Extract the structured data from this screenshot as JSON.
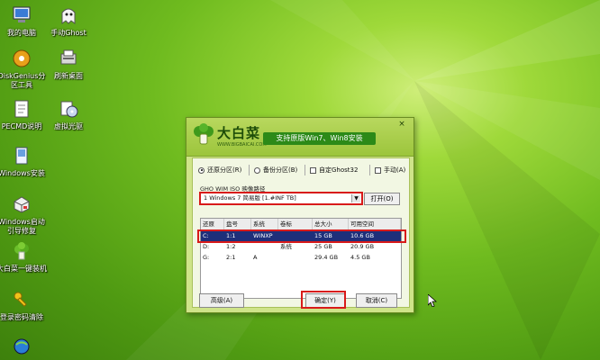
{
  "desktop": {
    "icons": [
      {
        "label": "我的电脑",
        "icon": "computer-icon"
      },
      {
        "label": "手动Ghost",
        "icon": "ghost-icon"
      },
      {
        "label": "DiskGenius分区工具",
        "icon": "disk-icon"
      },
      {
        "label": "刷新桌面",
        "icon": "refresh-icon"
      },
      {
        "label": "PECMD说明",
        "icon": "document-icon"
      },
      {
        "label": "虚拟光驱",
        "icon": "cdrom-icon"
      },
      {
        "label": "Windows安装",
        "icon": "install-icon"
      },
      {
        "label": "Windows启动引导修复",
        "icon": "repair-icon"
      },
      {
        "label": "大白菜一键装机",
        "icon": "cabbage-icon"
      },
      {
        "label": "登录密码清除",
        "icon": "key-icon"
      }
    ]
  },
  "dialog": {
    "logo_text": "大白菜",
    "logo_url": "WWW.BIGBAICAI.COM",
    "slogan": "支持原版Win7、Win8安装",
    "close": "×",
    "options": {
      "restore": "还原分区(R)",
      "backup": "备份分区(B)",
      "custom": "自定Ghost32",
      "manual": "手动(A)"
    },
    "path_label": "GHO WIM ISO 映像路径",
    "path_value": "1 Windows 7 简易版 [1.#INF TB]",
    "open_button": "打开(O)",
    "table": {
      "headers": [
        "还原",
        "盘号",
        "系统",
        "卷标",
        "总大小",
        "可用空间"
      ],
      "rows": [
        [
          "C:",
          "1:1",
          "WINXP",
          "",
          "15 GB",
          "10.6 GB"
        ],
        [
          "D:",
          "1:2",
          "",
          "系统",
          "25 GB",
          "20.9 GB"
        ],
        [
          "G:",
          "2:1",
          "A",
          "",
          "29.4 GB",
          "4.5 GB"
        ]
      ]
    },
    "buttons": {
      "advanced": "高级(A)",
      "ok": "确定(Y)",
      "cancel": "取消(C)"
    }
  },
  "colors": {
    "highlight": "#d81a1a",
    "selected_row": "#1e2f7a",
    "brand_green": "#2c8a18"
  }
}
